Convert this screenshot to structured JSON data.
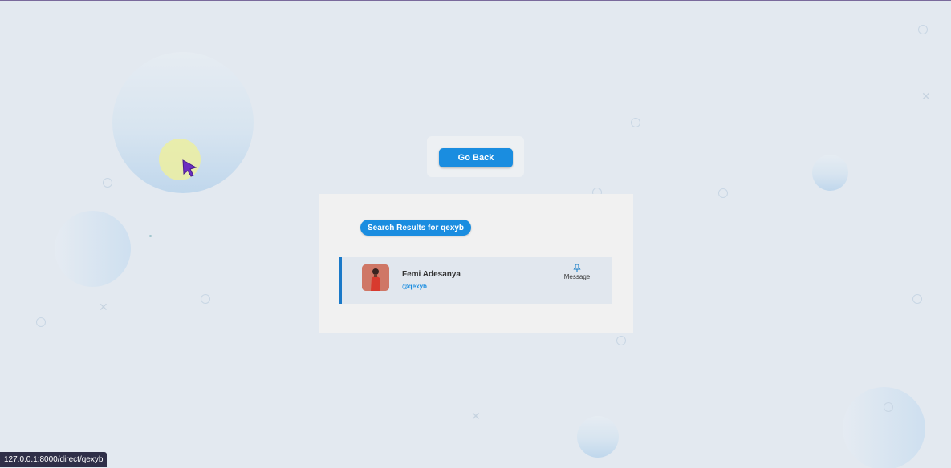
{
  "header": {
    "go_back_label": "Go Back"
  },
  "results": {
    "title": "Search Results for qexyb",
    "items": [
      {
        "name": "Femi Adesanya",
        "handle": "@qexyb",
        "action_label": "Message",
        "action_icon": "pin-icon"
      }
    ]
  },
  "status_bar": {
    "url": "127.0.0.1:8000/direct/qexyb"
  },
  "colors": {
    "accent": "#1a8de0",
    "background": "#e3e9f0",
    "panel": "#f1f1f1",
    "row": "#e1e7ee",
    "cursor": "#6b2fc0",
    "highlight": "#ecee a0"
  }
}
